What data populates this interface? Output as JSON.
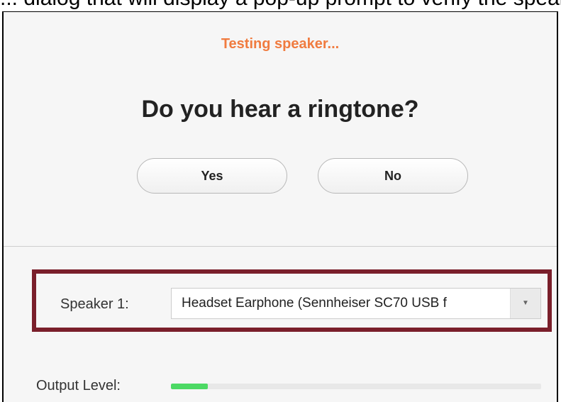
{
  "caption": {
    "text": "... dialog that will display a pop-up prompt to verify the speaker ..."
  },
  "dialog": {
    "status_text": "Testing speaker...",
    "question": "Do you hear a ringtone?",
    "yes_label": "Yes",
    "no_label": "No"
  },
  "speaker": {
    "label": "Speaker 1:",
    "selected": "Headset Earphone (Sennheiser SC70 USB f",
    "dropdown_icon": "chevron-down-icon"
  },
  "output": {
    "label": "Output Level:",
    "level": 0.1
  },
  "colors": {
    "status_accent": "#f07b3f",
    "highlight_border": "#7a1f2b",
    "level_fill": "#4cd964"
  }
}
